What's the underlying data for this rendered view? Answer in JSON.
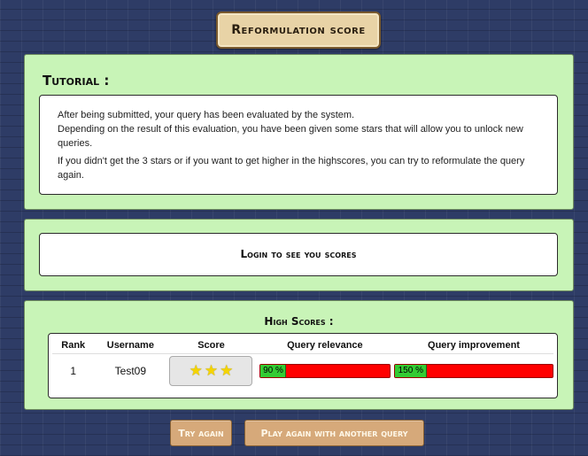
{
  "header": {
    "title": "Reformulation score"
  },
  "tutorial": {
    "title": "Tutorial :",
    "paragraphs": [
      "After being submitted, your query has been evaluated by the system.",
      "Depending on the result of this evaluation, you have been given some stars that will allow you to unlock new queries.",
      "If you didn't get the 3 stars or if you want to get higher in the highscores, you can try to reformulate the query again."
    ]
  },
  "login": {
    "text": "Login to see you scores"
  },
  "highscores": {
    "title": "High Scores :",
    "columns": [
      "Rank",
      "Username",
      "Score",
      "Query relevance",
      "Query improvement"
    ],
    "rows": [
      {
        "rank": "1",
        "username": "Test09",
        "stars": 3,
        "relevance_label": "90 %",
        "relevance_fraction": 0.2,
        "improvement_label": "150 %",
        "improvement_fraction": 0.2
      }
    ]
  },
  "buttons": {
    "try_again": "Try again",
    "play_another": "Play again with another query"
  },
  "colors": {
    "background": "#2e3c66",
    "panel": "#c8f4b7",
    "bar_empty": "#ff0000",
    "bar_fill": "#33cc33",
    "star": "#f5d400",
    "button": "#d6a97a"
  }
}
